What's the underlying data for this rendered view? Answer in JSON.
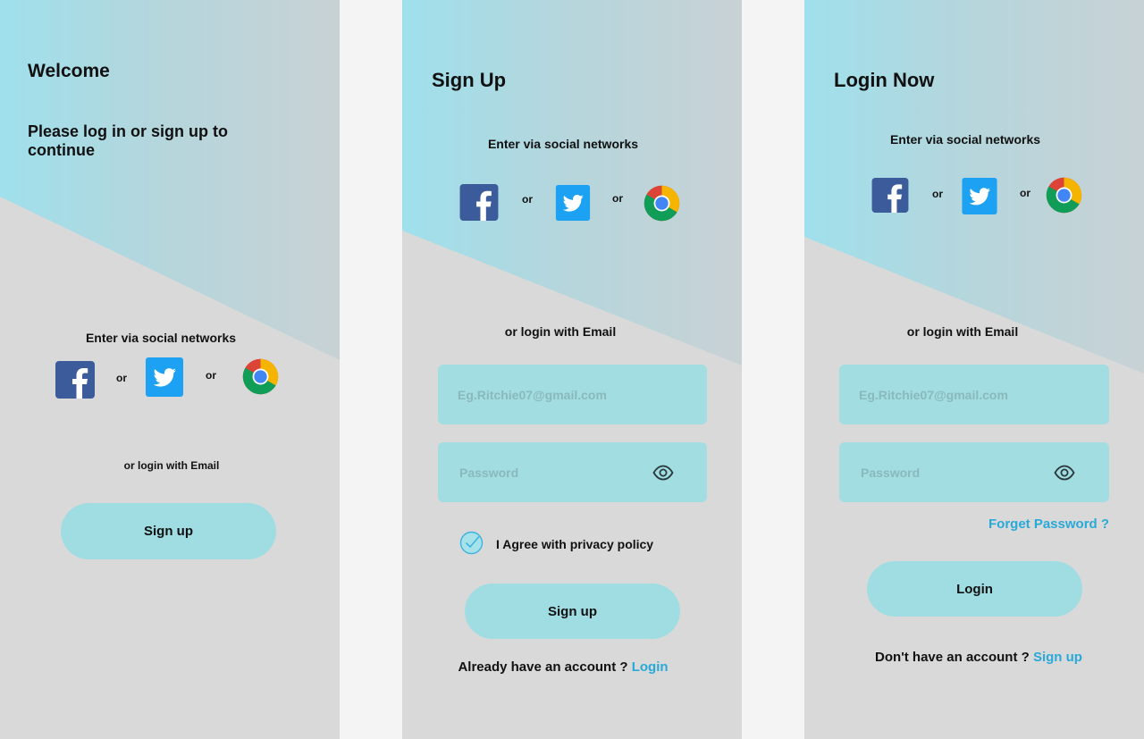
{
  "welcome": {
    "title": "Welcome",
    "subtitle": "Please log in or sign up to continue",
    "social_label": "Enter via social networks",
    "or1": "or",
    "or2": "or",
    "email_label": "or login with Email",
    "signup_button": "Sign up"
  },
  "signup": {
    "title": "Sign Up",
    "social_label": "Enter via social networks",
    "or1": "or",
    "or2": "or",
    "email_label": "or login with Email",
    "email_placeholder": "Eg.Ritchie07@gmail.com",
    "password_placeholder": "Password",
    "agree_label": "I Agree with privacy policy",
    "signup_button": "Sign up",
    "have_account": "Already have an account ?",
    "login_link": "Login"
  },
  "login": {
    "title": "Login Now",
    "social_label": "Enter via social networks",
    "or1": "or",
    "or2": "or",
    "email_label": "or login with Email",
    "email_placeholder": "Eg.Ritchie07@gmail.com",
    "password_placeholder": "Password",
    "forget_password": "Forget Password ?",
    "login_button": "Login",
    "no_account": "Don't have an account ?",
    "signup_link": "Sign up"
  },
  "colors": {
    "accent": "#29a9d8",
    "field": "#a2dde1",
    "button": "#a0dde3"
  }
}
